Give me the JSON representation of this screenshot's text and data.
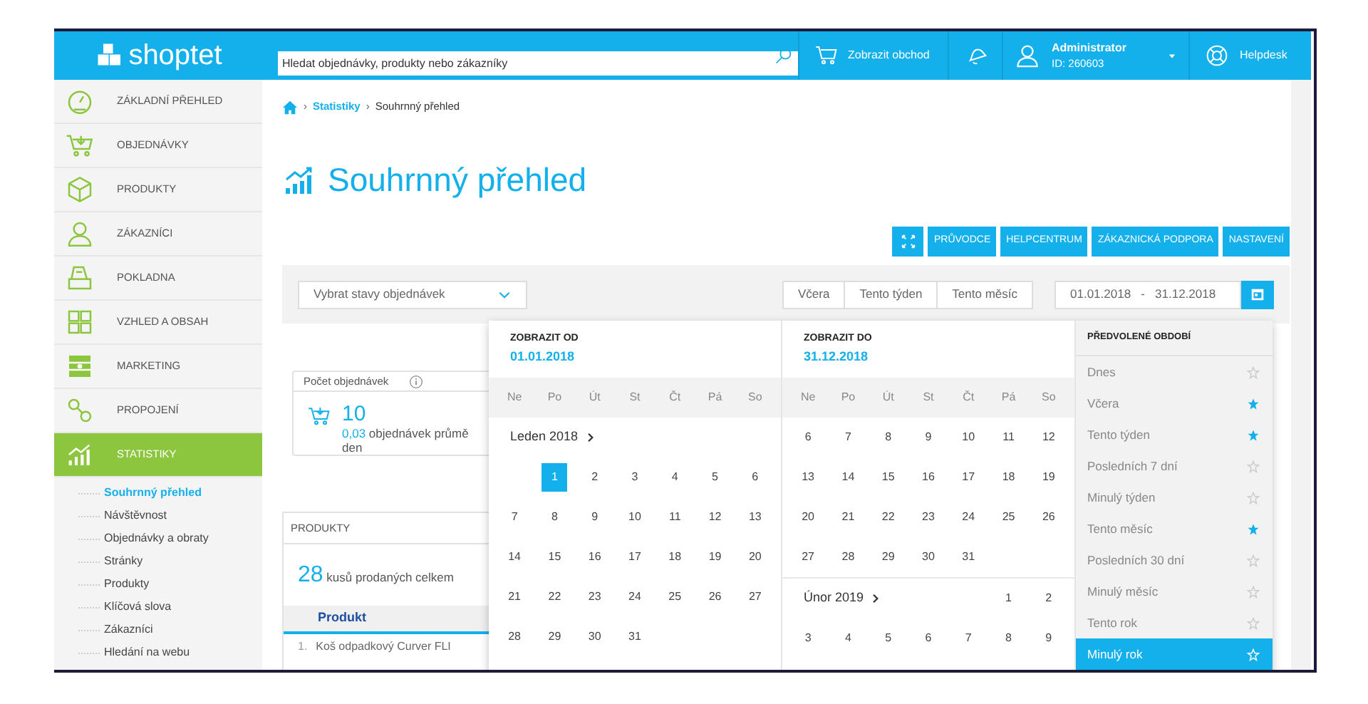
{
  "header": {
    "logo": "shoptet",
    "search": {
      "placeholder": "Hledat objednávky, produkty nebo zákazníky"
    },
    "shop_link": "Zobrazit obchod",
    "user": {
      "name": "Administrator",
      "id": "ID: 260603"
    },
    "helpdesk": "Helpdesk"
  },
  "sidebar": {
    "items": [
      {
        "label": "ZÁKLADNÍ PŘEHLED",
        "selected": false
      },
      {
        "label": "OBJEDNÁVKY",
        "selected": false
      },
      {
        "label": "PRODUKTY",
        "selected": false
      },
      {
        "label": "ZÁKAZNÍCI",
        "selected": false
      },
      {
        "label": "POKLADNA",
        "selected": false
      },
      {
        "label": "VZHLED A OBSAH",
        "selected": false
      },
      {
        "label": "MARKETING",
        "selected": false
      },
      {
        "label": "PROPOJENÍ",
        "selected": false
      },
      {
        "label": "STATISTIKY",
        "selected": true,
        "children": [
          {
            "label": "Souhrnný přehled",
            "selected": true
          },
          {
            "label": "Návštěvnost",
            "selected": false
          },
          {
            "label": "Objednávky a obraty",
            "selected": false
          },
          {
            "label": "Stránky",
            "selected": false
          },
          {
            "label": "Produkty",
            "selected": false
          },
          {
            "label": "Klíčová slova",
            "selected": false
          },
          {
            "label": "Zákazníci",
            "selected": false
          },
          {
            "label": "Hledání na webu",
            "selected": false
          }
        ]
      }
    ]
  },
  "breadcrumb": [
    {
      "separator": "›",
      "label": "Statistiky"
    },
    {
      "separator": "›",
      "label": "Souhrnný přehled"
    }
  ],
  "title": "Souhrnný přehled",
  "action_buttons": [
    "PRŮVODCE",
    "HELPCENTRUM",
    "ZÁKAZNICKÁ PODPORA",
    "NASTAVENÍ"
  ],
  "filter": {
    "status_select": "Vybrat stavy objednávek",
    "quick_ranges": [
      "Včera",
      "Tento týden",
      "Tento měsíc"
    ],
    "date_range": "01.01.2018   -   31.12.2018"
  },
  "orders_card": {
    "title": "Počet objednávek",
    "value": "10",
    "average": "0,03",
    "average_text": "objednávek průmě",
    "average_text_2": "den"
  },
  "products_card": {
    "title": "PRODUKTY",
    "count": "28",
    "count_text": "kusů prodaných celkem",
    "column": "Produkt",
    "rows": [
      {
        "rank": "1.",
        "name": "Koš odpadkový Curver FLI"
      }
    ]
  },
  "calendars": [
    {
      "label": "ZOBRAZIT OD",
      "date": "01.01.2018",
      "weekdays": [
        "Ne",
        "Po",
        "Út",
        "St",
        "Čt",
        "Pá",
        "So"
      ],
      "months": [
        {
          "title": "Leden 2018",
          "weeks": [
            [
              {
                "kind": "blank"
              },
              {
                "d": "1",
                "selected": true
              },
              {
                "d": "2",
                "selected": false
              },
              {
                "d": "3",
                "selected": false
              },
              {
                "d": "4",
                "selected": false
              },
              {
                "d": "5",
                "selected": false
              },
              {
                "d": "6",
                "selected": false
              }
            ],
            [
              {
                "d": "7",
                "selected": false
              },
              {
                "d": "8",
                "selected": false
              },
              {
                "d": "9",
                "selected": false
              },
              {
                "d": "10",
                "selected": false
              },
              {
                "d": "11",
                "selected": false
              },
              {
                "d": "12",
                "selected": false
              },
              {
                "d": "13",
                "selected": false
              }
            ],
            [
              {
                "d": "14",
                "selected": false
              },
              {
                "d": "15",
                "selected": false
              },
              {
                "d": "16",
                "selected": false
              },
              {
                "d": "17",
                "selected": false
              },
              {
                "d": "18",
                "selected": false
              },
              {
                "d": "19",
                "selected": false
              },
              {
                "d": "20",
                "selected": false
              }
            ],
            [
              {
                "d": "21",
                "selected": false
              },
              {
                "d": "22",
                "selected": false
              },
              {
                "d": "23",
                "selected": false
              },
              {
                "d": "24",
                "selected": false
              },
              {
                "d": "25",
                "selected": false
              },
              {
                "d": "26",
                "selected": false
              },
              {
                "d": "27",
                "selected": false
              }
            ],
            [
              {
                "d": "28",
                "selected": false
              },
              {
                "d": "29",
                "selected": false
              },
              {
                "d": "30",
                "selected": false
              },
              {
                "d": "31",
                "selected": false
              },
              {
                "kind": "blank"
              },
              {
                "kind": "blank"
              },
              {
                "kind": "blank"
              }
            ]
          ]
        }
      ]
    },
    {
      "label": "ZOBRAZIT DO",
      "date": "31.12.2018",
      "weekdays": [
        "Ne",
        "Po",
        "Út",
        "St",
        "Čt",
        "Pá",
        "So"
      ],
      "months": [
        {
          "weeks": [
            [
              {
                "d": "6",
                "selected": false
              },
              {
                "d": "7",
                "selected": false
              },
              {
                "d": "8",
                "selected": false
              },
              {
                "d": "9",
                "selected": false
              },
              {
                "d": "10",
                "selected": false
              },
              {
                "d": "11",
                "selected": false
              },
              {
                "d": "12",
                "selected": false
              }
            ],
            [
              {
                "d": "13",
                "selected": false
              },
              {
                "d": "14",
                "selected": false
              },
              {
                "d": "15",
                "selected": false
              },
              {
                "d": "16",
                "selected": false
              },
              {
                "d": "17",
                "selected": false
              },
              {
                "d": "18",
                "selected": false
              },
              {
                "d": "19",
                "selected": false
              }
            ],
            [
              {
                "d": "20",
                "selected": false
              },
              {
                "d": "21",
                "selected": false
              },
              {
                "d": "22",
                "selected": false
              },
              {
                "d": "23",
                "selected": false
              },
              {
                "d": "24",
                "selected": false
              },
              {
                "d": "25",
                "selected": false
              },
              {
                "d": "26",
                "selected": false
              }
            ],
            [
              {
                "d": "27",
                "selected": false
              },
              {
                "d": "28",
                "selected": false
              },
              {
                "d": "29",
                "selected": false
              },
              {
                "d": "30",
                "selected": false
              },
              {
                "d": "31",
                "selected": false
              },
              {
                "kind": "blank"
              },
              {
                "kind": "blank"
              }
            ]
          ]
        },
        {
          "title": "Únor 2019",
          "weeks": [
            [
              {
                "kind": "blank"
              },
              {
                "kind": "blank"
              },
              {
                "kind": "blank"
              },
              {
                "kind": "blank"
              },
              {
                "kind": "blank"
              },
              {
                "d": "1",
                "selected": false
              },
              {
                "d": "2",
                "selected": false
              }
            ],
            [
              {
                "d": "3",
                "selected": false
              },
              {
                "d": "4",
                "selected": false
              },
              {
                "d": "5",
                "selected": false
              },
              {
                "d": "6",
                "selected": false
              },
              {
                "d": "7",
                "selected": false
              },
              {
                "d": "8",
                "selected": false
              },
              {
                "d": "9",
                "selected": false
              }
            ]
          ]
        }
      ]
    }
  ],
  "presets": {
    "title": "PŘEDVOLENÉ OBDOBÍ",
    "items": [
      {
        "label": "Dnes",
        "starred": false,
        "selected": false
      },
      {
        "label": "Včera",
        "starred": true,
        "selected": false
      },
      {
        "label": "Tento týden",
        "starred": true,
        "selected": false
      },
      {
        "label": "Posledních 7 dní",
        "starred": false,
        "selected": false
      },
      {
        "label": "Minulý týden",
        "starred": false,
        "selected": false
      },
      {
        "label": "Tento měsíc",
        "starred": true,
        "selected": false
      },
      {
        "label": "Posledních 30 dní",
        "starred": false,
        "selected": false
      },
      {
        "label": "Minulý měsíc",
        "starred": false,
        "selected": false
      },
      {
        "label": "Tento rok",
        "starred": false,
        "selected": false
      },
      {
        "label": "Minulý rok",
        "starred": false,
        "selected": true
      }
    ]
  }
}
